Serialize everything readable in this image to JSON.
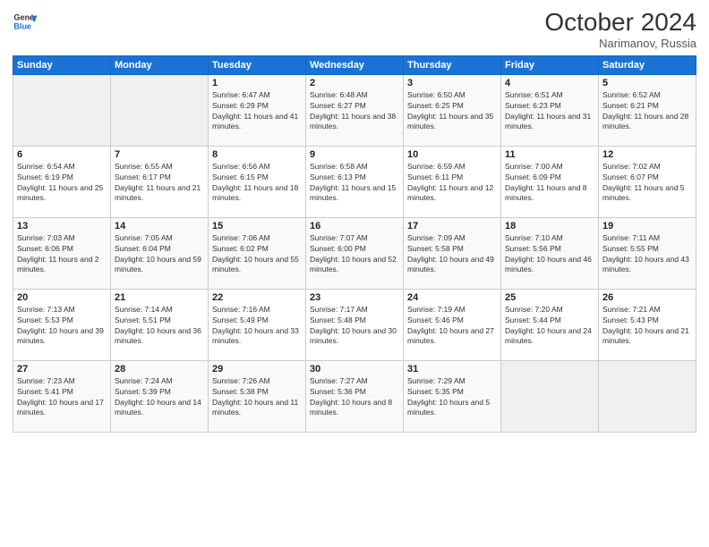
{
  "logo": {
    "line1": "General",
    "line2": "Blue"
  },
  "title": "October 2024",
  "subtitle": "Narimanov, Russia",
  "days_header": [
    "Sunday",
    "Monday",
    "Tuesday",
    "Wednesday",
    "Thursday",
    "Friday",
    "Saturday"
  ],
  "weeks": [
    [
      {
        "num": "",
        "info": ""
      },
      {
        "num": "",
        "info": ""
      },
      {
        "num": "1",
        "info": "Sunrise: 6:47 AM\nSunset: 6:29 PM\nDaylight: 11 hours and 41 minutes."
      },
      {
        "num": "2",
        "info": "Sunrise: 6:48 AM\nSunset: 6:27 PM\nDaylight: 11 hours and 38 minutes."
      },
      {
        "num": "3",
        "info": "Sunrise: 6:50 AM\nSunset: 6:25 PM\nDaylight: 11 hours and 35 minutes."
      },
      {
        "num": "4",
        "info": "Sunrise: 6:51 AM\nSunset: 6:23 PM\nDaylight: 11 hours and 31 minutes."
      },
      {
        "num": "5",
        "info": "Sunrise: 6:52 AM\nSunset: 6:21 PM\nDaylight: 11 hours and 28 minutes."
      }
    ],
    [
      {
        "num": "6",
        "info": "Sunrise: 6:54 AM\nSunset: 6:19 PM\nDaylight: 11 hours and 25 minutes."
      },
      {
        "num": "7",
        "info": "Sunrise: 6:55 AM\nSunset: 6:17 PM\nDaylight: 11 hours and 21 minutes."
      },
      {
        "num": "8",
        "info": "Sunrise: 6:56 AM\nSunset: 6:15 PM\nDaylight: 11 hours and 18 minutes."
      },
      {
        "num": "9",
        "info": "Sunrise: 6:58 AM\nSunset: 6:13 PM\nDaylight: 11 hours and 15 minutes."
      },
      {
        "num": "10",
        "info": "Sunrise: 6:59 AM\nSunset: 6:11 PM\nDaylight: 11 hours and 12 minutes."
      },
      {
        "num": "11",
        "info": "Sunrise: 7:00 AM\nSunset: 6:09 PM\nDaylight: 11 hours and 8 minutes."
      },
      {
        "num": "12",
        "info": "Sunrise: 7:02 AM\nSunset: 6:07 PM\nDaylight: 11 hours and 5 minutes."
      }
    ],
    [
      {
        "num": "13",
        "info": "Sunrise: 7:03 AM\nSunset: 6:06 PM\nDaylight: 11 hours and 2 minutes."
      },
      {
        "num": "14",
        "info": "Sunrise: 7:05 AM\nSunset: 6:04 PM\nDaylight: 10 hours and 59 minutes."
      },
      {
        "num": "15",
        "info": "Sunrise: 7:06 AM\nSunset: 6:02 PM\nDaylight: 10 hours and 55 minutes."
      },
      {
        "num": "16",
        "info": "Sunrise: 7:07 AM\nSunset: 6:00 PM\nDaylight: 10 hours and 52 minutes."
      },
      {
        "num": "17",
        "info": "Sunrise: 7:09 AM\nSunset: 5:58 PM\nDaylight: 10 hours and 49 minutes."
      },
      {
        "num": "18",
        "info": "Sunrise: 7:10 AM\nSunset: 5:56 PM\nDaylight: 10 hours and 46 minutes."
      },
      {
        "num": "19",
        "info": "Sunrise: 7:11 AM\nSunset: 5:55 PM\nDaylight: 10 hours and 43 minutes."
      }
    ],
    [
      {
        "num": "20",
        "info": "Sunrise: 7:13 AM\nSunset: 5:53 PM\nDaylight: 10 hours and 39 minutes."
      },
      {
        "num": "21",
        "info": "Sunrise: 7:14 AM\nSunset: 5:51 PM\nDaylight: 10 hours and 36 minutes."
      },
      {
        "num": "22",
        "info": "Sunrise: 7:16 AM\nSunset: 5:49 PM\nDaylight: 10 hours and 33 minutes."
      },
      {
        "num": "23",
        "info": "Sunrise: 7:17 AM\nSunset: 5:48 PM\nDaylight: 10 hours and 30 minutes."
      },
      {
        "num": "24",
        "info": "Sunrise: 7:19 AM\nSunset: 5:46 PM\nDaylight: 10 hours and 27 minutes."
      },
      {
        "num": "25",
        "info": "Sunrise: 7:20 AM\nSunset: 5:44 PM\nDaylight: 10 hours and 24 minutes."
      },
      {
        "num": "26",
        "info": "Sunrise: 7:21 AM\nSunset: 5:43 PM\nDaylight: 10 hours and 21 minutes."
      }
    ],
    [
      {
        "num": "27",
        "info": "Sunrise: 7:23 AM\nSunset: 5:41 PM\nDaylight: 10 hours and 17 minutes."
      },
      {
        "num": "28",
        "info": "Sunrise: 7:24 AM\nSunset: 5:39 PM\nDaylight: 10 hours and 14 minutes."
      },
      {
        "num": "29",
        "info": "Sunrise: 7:26 AM\nSunset: 5:38 PM\nDaylight: 10 hours and 11 minutes."
      },
      {
        "num": "30",
        "info": "Sunrise: 7:27 AM\nSunset: 5:36 PM\nDaylight: 10 hours and 8 minutes."
      },
      {
        "num": "31",
        "info": "Sunrise: 7:29 AM\nSunset: 5:35 PM\nDaylight: 10 hours and 5 minutes."
      },
      {
        "num": "",
        "info": ""
      },
      {
        "num": "",
        "info": ""
      }
    ]
  ]
}
